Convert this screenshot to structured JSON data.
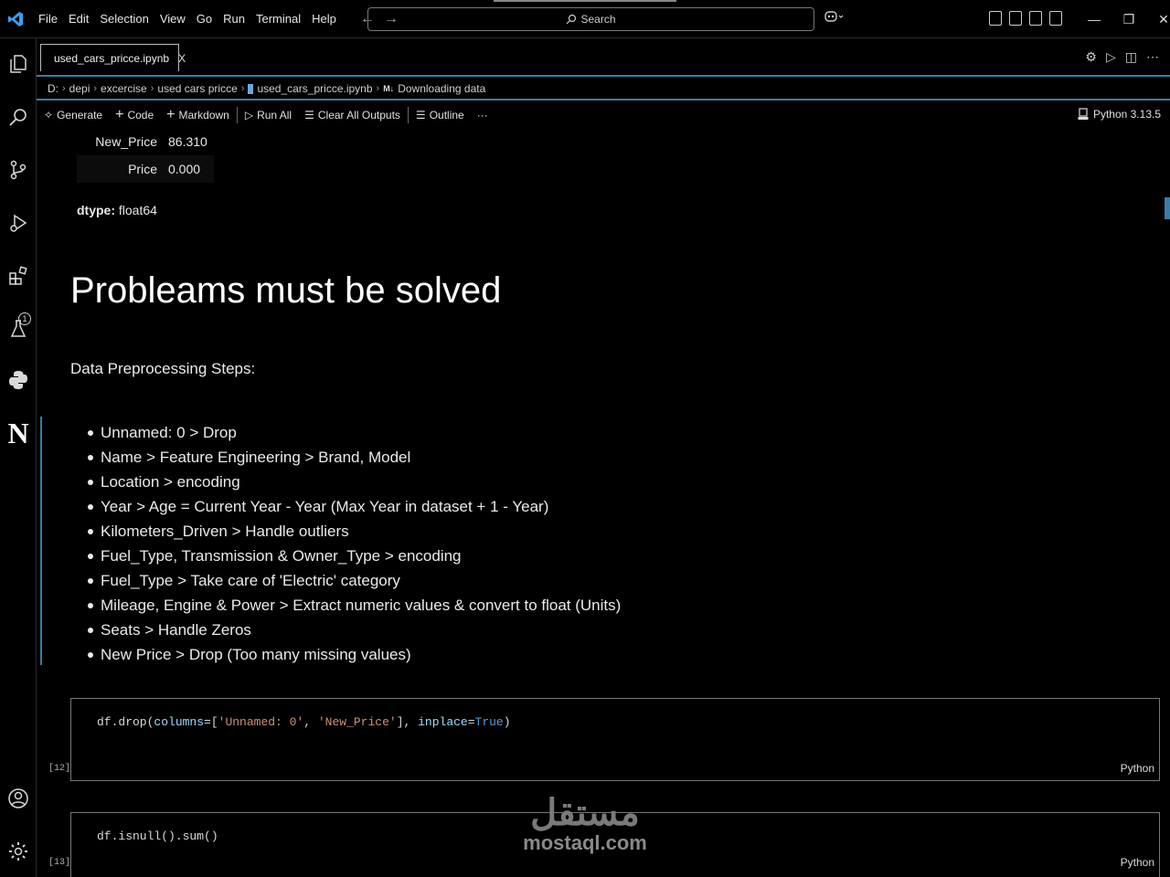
{
  "titlebar": {
    "menu": [
      "File",
      "Edit",
      "Selection",
      "View",
      "Go",
      "Run",
      "Terminal",
      "Help"
    ],
    "search_placeholder": "Search"
  },
  "tab": {
    "label": "used_cars_pricce.ipynb",
    "close": "X"
  },
  "breadcrumb": {
    "items": [
      "D:",
      "depi",
      "excercise",
      "used cars pricce",
      "used_cars_pricce.ipynb"
    ],
    "md_tag": "M↓",
    "section": "Downloading data"
  },
  "toolbar": {
    "generate": "Generate",
    "code": "Code",
    "markdown": "Markdown",
    "run_all": "Run All",
    "clear_outputs": "Clear All Outputs",
    "outline": "Outline",
    "more": "···",
    "kernel": "Python 3.13.5"
  },
  "output": {
    "rows": [
      {
        "key": "New_Price",
        "value": "86.310"
      },
      {
        "key": "Price",
        "value": "0.000"
      }
    ],
    "dtype_label": "dtype:",
    "dtype_value": "float64"
  },
  "markdown": {
    "heading": "Probleams must be solved",
    "paragraph": "Data Preprocessing Steps:",
    "items": [
      "Unnamed: 0 > Drop",
      "Name > Feature Engineering > Brand, Model",
      "Location > encoding",
      "Year > Age = Current Year - Year (Max Year in dataset + 1 - Year)",
      "Kilometers_Driven > Handle outliers",
      "Fuel_Type, Transmission & Owner_Type > encoding",
      "Fuel_Type > Take care of 'Electric' category",
      "Mileage, Engine & Power > Extract numeric values & convert to float (Units)",
      "Seats > Handle Zeros",
      "New Price > Drop (Too many missing values)"
    ]
  },
  "cells": [
    {
      "count": "[12]",
      "code_parts": {
        "a": "df.drop(",
        "b": "columns",
        "c": "=[",
        "d": "'Unnamed: 0'",
        "e": ", ",
        "f": "'New_Price'",
        "g": "], ",
        "h": "inplace",
        "i": "=",
        "j": "True",
        "k": ")"
      },
      "lang": "Python"
    },
    {
      "count": "[13]",
      "code": "df.isnull().sum()",
      "lang": "Python"
    }
  ],
  "watermark": {
    "arabic": "مستقل",
    "latin": "mostaql.com"
  },
  "colors": {
    "accent": "#3a7ca5",
    "background": "#000000"
  }
}
